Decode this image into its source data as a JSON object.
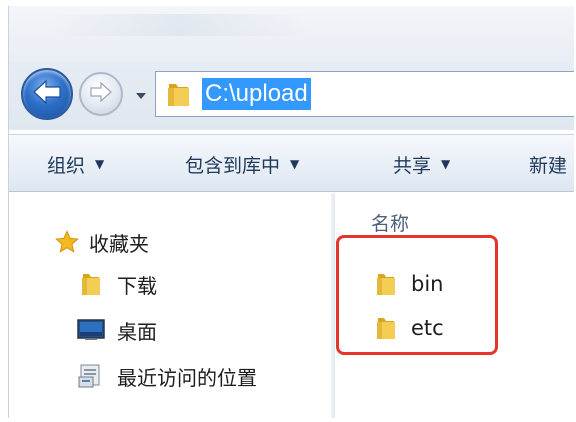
{
  "address": {
    "path": "C:\\upload"
  },
  "toolbar": {
    "items": [
      {
        "label": "组织"
      },
      {
        "label": "包含到库中"
      },
      {
        "label": "共享"
      },
      {
        "label": "新建"
      }
    ]
  },
  "nav": {
    "favorites_label": "收藏夹",
    "items": [
      {
        "label": "下载",
        "icon": "folder-icon"
      },
      {
        "label": "桌面",
        "icon": "desktop-icon"
      },
      {
        "label": "最近访问的位置",
        "icon": "recent-places-icon"
      }
    ]
  },
  "content": {
    "column_header": "名称",
    "files": [
      {
        "name": "bin",
        "icon": "folder-icon"
      },
      {
        "name": "etc",
        "icon": "folder-icon"
      }
    ]
  },
  "colors": {
    "selection": "#3399ff",
    "annotation": "#e5352b",
    "folder": "#f2c94c"
  }
}
